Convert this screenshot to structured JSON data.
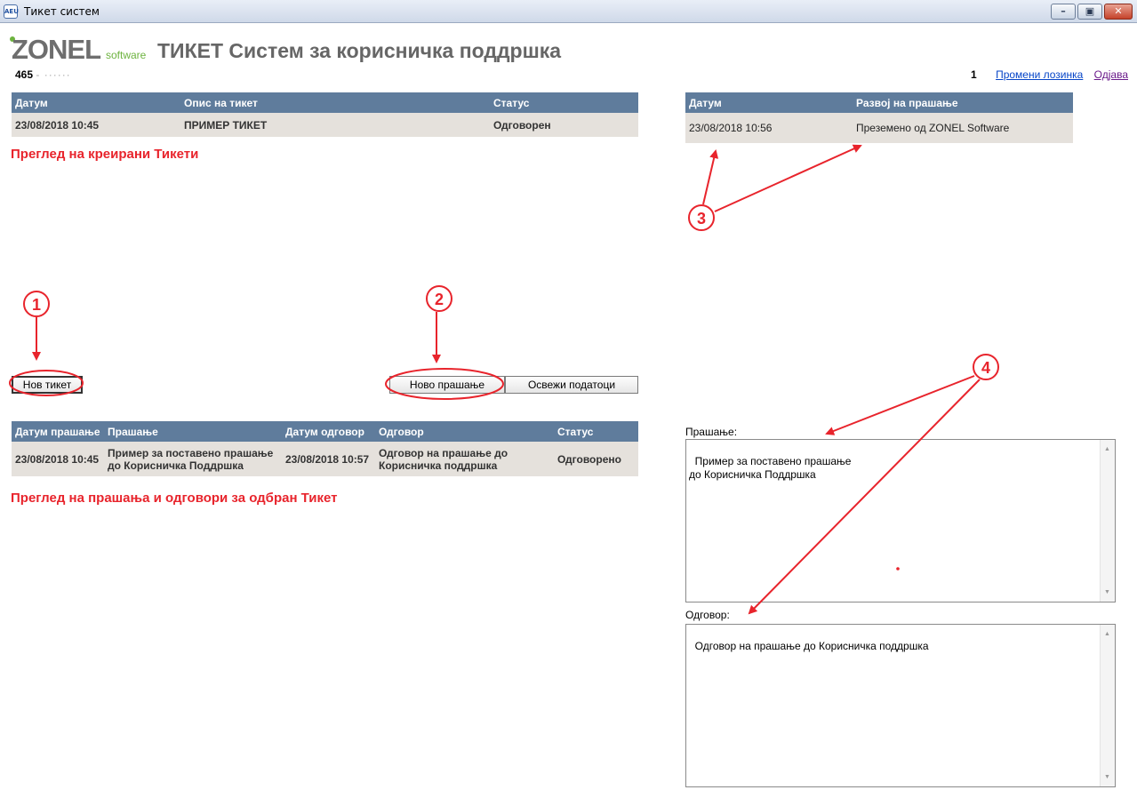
{
  "window": {
    "title": "Тикет систем",
    "icon": "app-icon",
    "icon_text": "AEU"
  },
  "header": {
    "logo_main": "ZONEL",
    "logo_sub": "software",
    "title": "ТИКЕТ Систем за корисничка поддршка",
    "user_id": "465",
    "user_name": "-  ······",
    "count": "1",
    "change_password": "Промени лозинка",
    "logout": "Одјава"
  },
  "tickets": {
    "columns": [
      "Датум",
      "Опис на тикет",
      "Статус"
    ],
    "rows": [
      {
        "date": "23/08/2018 10:45",
        "description": "ПРИМЕР ТИКЕТ",
        "status": "Одговорен"
      }
    ],
    "note": "Преглед на креирани Тикети"
  },
  "history": {
    "columns": [
      "Датум",
      "Развој на прашање"
    ],
    "rows": [
      {
        "date": "23/08/2018 10:56",
        "event": "Преземено од ZONEL Software"
      }
    ]
  },
  "buttons": {
    "new_ticket": "Нов тикет",
    "new_question": "Ново прашање",
    "refresh": "Освежи податоци"
  },
  "qa": {
    "columns": [
      "Датум прашање",
      "Прашање",
      "Датум одговор",
      "Одговор",
      "Статус"
    ],
    "rows": [
      {
        "q_date": "23/08/2018 10:45",
        "question": "Пример за поставено прашање до Корисничка Поддршка",
        "a_date": "23/08/2018 10:57",
        "answer": "Одговор на прашање до Корисничка поддршка",
        "status": "Одговорено"
      }
    ],
    "note": "Преглед на прашања и одговори за одбран Тикет"
  },
  "detail": {
    "question_label": "Прашање:",
    "question_text": "Пример за поставено прашање\nдо Корисничка Поддршка",
    "answer_label": "Одговор:",
    "answer_text": "Одговор на прашање до Корисничка поддршка"
  },
  "annotations": {
    "color": "#e8242c",
    "markers": [
      "1",
      "2",
      "3",
      "4"
    ]
  },
  "colors": {
    "table_header": "#5f7c9c",
    "row_bg": "#e5e1dc",
    "accent_red": "#e8242c"
  }
}
